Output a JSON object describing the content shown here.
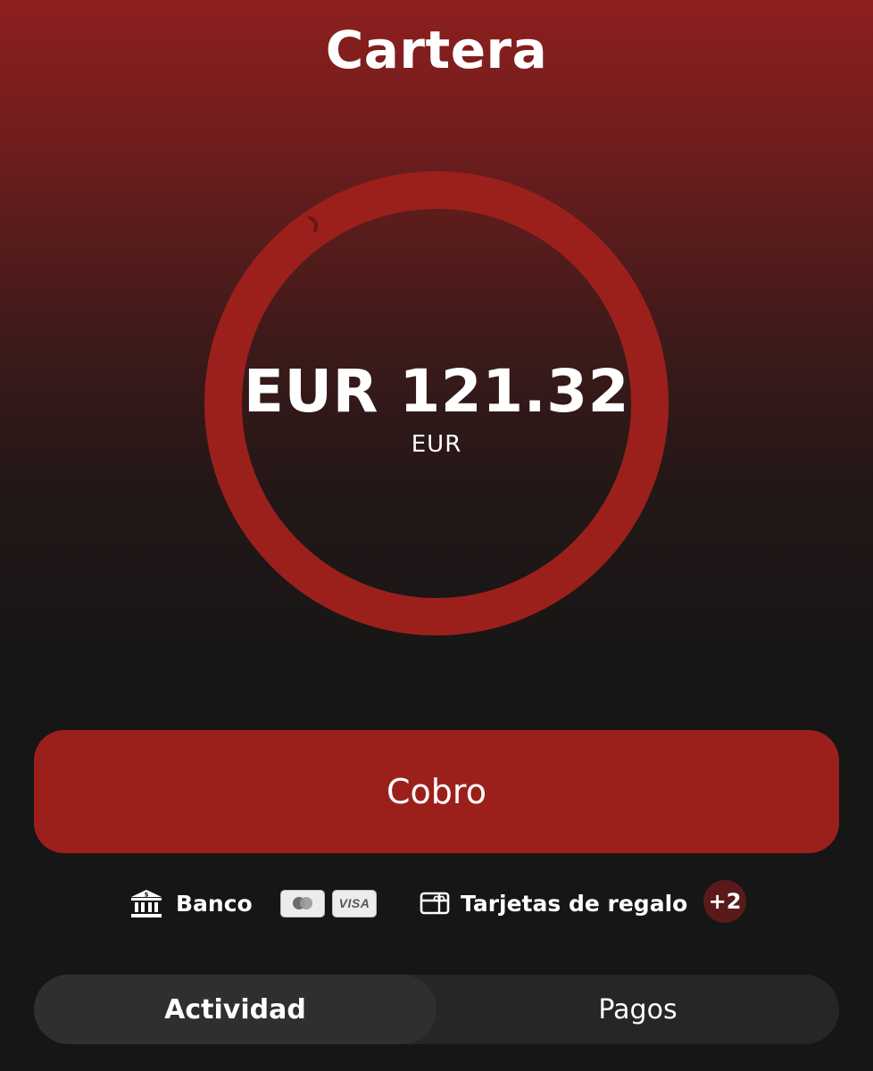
{
  "header": {
    "title": "Cartera"
  },
  "balance": {
    "amount_text": "EUR 121.32",
    "currency": "EUR"
  },
  "actions": {
    "collect_label": "Cobro"
  },
  "payment_methods": {
    "bank_label": "Banco",
    "bank_icon": "bank-icon",
    "card_logos": [
      "mastercard-logo",
      "visa-logo"
    ],
    "visa_text": "VISA",
    "gift_label": "Tarjetas de regalo",
    "gift_icon": "gift-card-icon",
    "more_count": "+2"
  },
  "tabs": [
    {
      "label": "Actividad",
      "selected": true
    },
    {
      "label": "Pagos",
      "selected": false
    }
  ],
  "colors": {
    "accent_red": "#9b201c",
    "background": "#161616",
    "badge_bg": "#5a1a1a",
    "tab_bar": "#262626"
  }
}
